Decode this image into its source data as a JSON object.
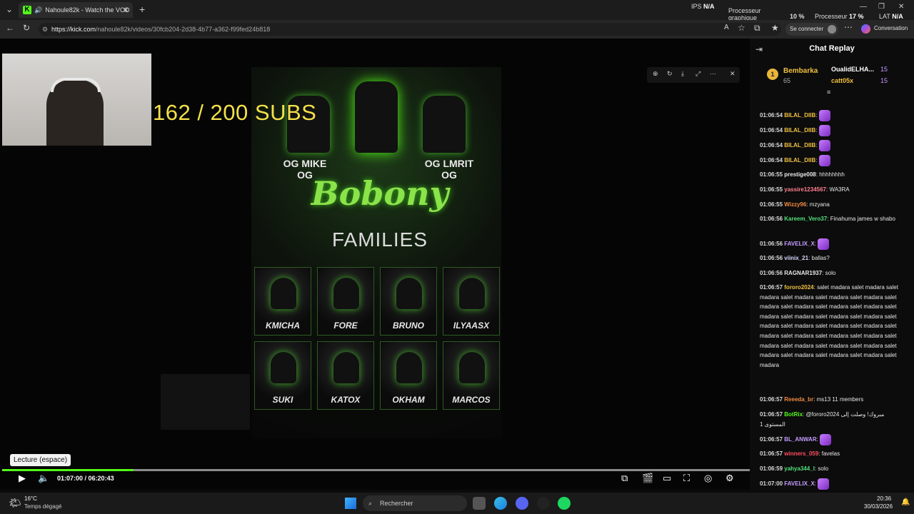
{
  "browser": {
    "tab_title": "Nahoule82k - Watch the VOD",
    "url_host": "https://kick.com",
    "url_path": "/nahoule82k/videos/30fcb204-2d38-4b77-a362-f99fed24b818",
    "signin_label": "Se connecter",
    "conversation_label": "Conversation"
  },
  "hardware": {
    "ips_label": "IPS",
    "ips_value": "N/A",
    "cpu_label": "Processeur graphique",
    "cpu_value": "10 %",
    "gpu_label": "Processeur",
    "gpu_value": "17 %",
    "lat_label": "LAT",
    "lat_value": "N/A"
  },
  "video": {
    "subs_text": "162 / 200  SUBS",
    "tooltip": "Lecture (espace)",
    "current_time": "01:07:00",
    "duration": "06:20:43",
    "progress_fraction": 0.176
  },
  "poster": {
    "og_left_1": "OG MIKE",
    "og_left_2": "OG",
    "og_right_1": "OG LMRIT",
    "og_right_2": "OG",
    "brand": "Bobony",
    "families": "FAMILIES",
    "members_row1": [
      "KMICHA",
      "FORE",
      "BRUNO",
      "ILYAASX"
    ],
    "members_row2": [
      "SUKI",
      "KATOX",
      "OKHAM",
      "MARCOS"
    ]
  },
  "chat": {
    "title": "Chat Replay",
    "leader": {
      "rank": "1",
      "name": "Bembarka",
      "count": "65"
    },
    "top2": {
      "name": "OualidELHA...",
      "count": "15"
    },
    "top3": {
      "name": "catt05x",
      "count": "15"
    },
    "messages": [
      {
        "time": "01:06:54",
        "user": "BILAL_DIIB",
        "color": "#f0c040",
        "text": "",
        "emote": true
      },
      {
        "time": "01:06:54",
        "user": "BILAL_DIIB",
        "color": "#f0c040",
        "text": "",
        "emote": true
      },
      {
        "time": "01:06:54",
        "user": "BILAL_DIIB",
        "color": "#f0c040",
        "text": "",
        "emote": true
      },
      {
        "time": "01:06:54",
        "user": "BILAL_DIIB",
        "color": "#f0c040",
        "text": "",
        "emote": true
      },
      {
        "time": "01:06:55",
        "user": "prestige008",
        "color": "#e8e8e8",
        "text": "hhhhhhhh",
        "emote": false
      },
      {
        "time": "01:06:55",
        "user": "yassire1234567",
        "color": "#ff7f8f",
        "text": "WA3RA",
        "emote": false
      },
      {
        "time": "01:06:55",
        "user": "Wizzy96",
        "color": "#f08a40",
        "text": "mzyana",
        "emote": false
      },
      {
        "time": "01:06:56",
        "user": "Kareem_Vero37",
        "color": "#53e07a",
        "text": "Finahuma james w shabo",
        "emote": false
      },
      {
        "time": "01:06:56",
        "user": "FAVELIX_X",
        "color": "#c49cff",
        "text": "",
        "emote": true
      },
      {
        "time": "01:06:56",
        "user": "viinix_21",
        "color": "#d8d8ff",
        "text": "ballas?",
        "emote": false
      },
      {
        "time": "01:06:56",
        "user": "RAGNAR1937",
        "color": "#e8e8e8",
        "text": "solo",
        "emote": false
      },
      {
        "time": "01:06:57",
        "user": "fororo2024",
        "color": "#f0c040",
        "text": "salet madara salet madara salet madara salet madara salet madara salet madara salet madara salet madara salet madara salet madara salet madara salet madara salet madara salet madara salet madara salet madara salet madara salet madara salet madara salet madara salet madara salet madara salet madara salet madara salet madara salet madara salet madara salet madara salet madara salet madara salet madara",
        "emote": false
      },
      {
        "time": "01:06:57",
        "user": "Reeeda_br",
        "color": "#f08a40",
        "text": "ms13 11 members",
        "emote": false
      },
      {
        "time": "01:06:57",
        "user": "BotRix",
        "color": "#53fc18",
        "text": "@fororo2024 مبروك! وصلت إلى المستوى 1",
        "emote": false
      },
      {
        "time": "01:06:57",
        "user": "BL_ANWAR",
        "color": "#c49cff",
        "text": "",
        "emote": true
      },
      {
        "time": "01:06:57",
        "user": "winners_059",
        "color": "#ff4d5e",
        "text": "favelas",
        "emote": false
      },
      {
        "time": "01:06:59",
        "user": "yahya344_l",
        "color": "#53e07a",
        "text": "solo",
        "emote": false
      },
      {
        "time": "01:07:00",
        "user": "FAVELIX_X",
        "color": "#c49cff",
        "text": "",
        "emote": true
      }
    ]
  },
  "taskbar": {
    "temp": "16°C",
    "weather": "Temps dégagé",
    "search": "Rechercher",
    "clock_time": "20:36",
    "clock_date": "30/03/2026"
  }
}
